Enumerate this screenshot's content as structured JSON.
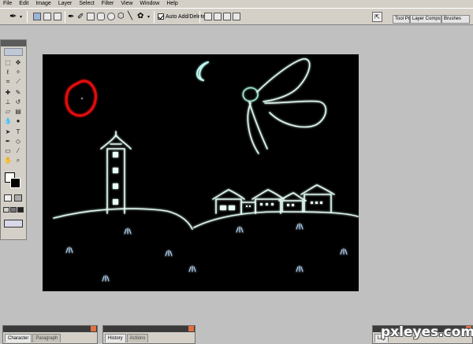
{
  "menu": [
    "File",
    "Edit",
    "Image",
    "Layer",
    "Select",
    "Filter",
    "View",
    "Window",
    "Help"
  ],
  "options": {
    "auto_add_delete_label": "Auto Add/Delete",
    "auto_add_delete_checked": true
  },
  "palette_well": {
    "tabs": [
      "Tool Pr",
      "Layer Comps",
      "Brushes"
    ]
  },
  "bottom_palettes": [
    {
      "tabs": [
        "Character",
        "Paragraph"
      ]
    },
    {
      "tabs": [
        "History",
        "Actions"
      ]
    },
    {
      "tabs": [
        "Lay"
      ]
    }
  ],
  "watermark": "pxleyes.com",
  "colors": {
    "ui_gray": "#d4d0c8",
    "workspace": "#c0c0c0",
    "canvas_bg": "#000000",
    "glow_line": "#dff8f0",
    "sun_red": "#e01010"
  },
  "icons": [
    "pen-icon",
    "path-icon",
    "move-icon",
    "marquee-icon",
    "lasso-icon",
    "crop-icon",
    "brush-icon",
    "text-icon",
    "hand-icon",
    "zoom-icon"
  ]
}
